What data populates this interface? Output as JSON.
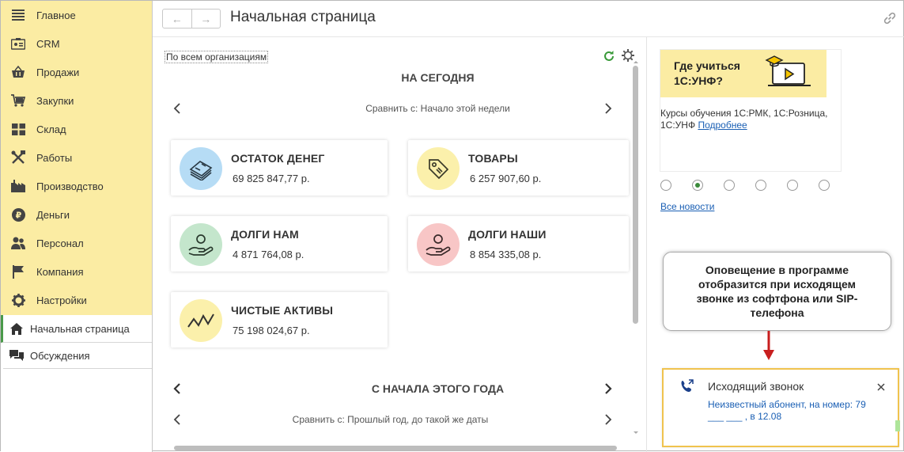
{
  "sidebar": {
    "items": [
      {
        "label": "Главное",
        "icon": "hamburger-icon"
      },
      {
        "label": "CRM",
        "icon": "contact-card-icon"
      },
      {
        "label": "Продажи",
        "icon": "basket-icon"
      },
      {
        "label": "Закупки",
        "icon": "cart-icon"
      },
      {
        "label": "Склад",
        "icon": "warehouse-grid-icon"
      },
      {
        "label": "Работы",
        "icon": "tools-icon"
      },
      {
        "label": "Производство",
        "icon": "factory-icon"
      },
      {
        "label": "Деньги",
        "icon": "ruble-coin-icon"
      },
      {
        "label": "Персонал",
        "icon": "people-icon"
      },
      {
        "label": "Компания",
        "icon": "flag-icon"
      },
      {
        "label": "Настройки",
        "icon": "gear-icon"
      }
    ],
    "home": {
      "label": "Начальная страница",
      "icon": "home-icon"
    },
    "discussions": {
      "label": "Обсуждения",
      "icon": "chat-bubbles-icon"
    }
  },
  "header": {
    "title": "Начальная страница",
    "back_icon": "arrow-left-icon",
    "forward_icon": "arrow-right-icon",
    "link_icon": "link-icon"
  },
  "main": {
    "org_filter": "По всем организациям",
    "today": {
      "title": "НА СЕГОДНЯ",
      "compare": "Сравнить с: Начало этой недели"
    },
    "cards": [
      {
        "title": "ОСТАТОК ДЕНЕГ",
        "value": "69 825 847,77 р.",
        "color": "#b6dcf5",
        "icon": "money-stack-icon"
      },
      {
        "title": "ТОВАРЫ",
        "value": "6 257 907,60 р.",
        "color": "#fbf0ab",
        "icon": "price-tag-icon"
      },
      {
        "title": "ДОЛГИ НАМ",
        "value": "4 871 764,08 р.",
        "color": "#c4e6cc",
        "icon": "hand-person-icon"
      },
      {
        "title": "ДОЛГИ НАШИ",
        "value": "8 854 335,08 р.",
        "color": "#f8c6c6",
        "icon": "hand-person-icon"
      },
      {
        "title": "ЧИСТЫЕ АКТИВЫ",
        "value": "75 198 024,67 р.",
        "color": "#fbf0ab",
        "icon": "trend-line-icon"
      }
    ],
    "year": {
      "title": "С НАЧАЛА ЭТОГО ГОДА",
      "compare": "Сравнить с: Прошлый год, до такой же даты"
    }
  },
  "news": {
    "banner": "Где учиться 1С:УНФ?",
    "text": "Курсы обучения 1С:РМК, 1С:Розница, 1С:УНФ",
    "more": "Подробнее",
    "all_news": "Все новости",
    "slides": 6,
    "selected_slide": 2
  },
  "callout": {
    "text": "Оповещение в программе отобразится при исходящем звонке из софтфона или SIP-телефона"
  },
  "toast": {
    "title": "Исходящий звонок",
    "body": "Неизвестный абонент, на номер: 79 ___ ___ , в 12.08",
    "accent": "#f0c34e"
  },
  "colors": {
    "sidebar_bg": "#fbeca3",
    "link": "#1a5fb4",
    "active_marker": "#4a9a4a"
  }
}
